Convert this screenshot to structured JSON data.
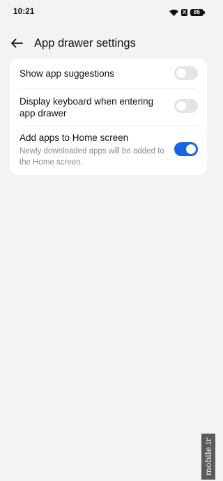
{
  "status_bar": {
    "time": "10:21",
    "battery": "85",
    "badge": "X"
  },
  "header": {
    "title": "App drawer settings",
    "back_icon": "arrow-left-icon"
  },
  "settings": [
    {
      "title": "Show app suggestions",
      "subtitle": "",
      "enabled": false
    },
    {
      "title": "Display keyboard when entering app drawer",
      "subtitle": "",
      "enabled": false
    },
    {
      "title": "Add apps to Home screen",
      "subtitle": "Newly downloaded apps will be added to the Home screen.",
      "enabled": true
    }
  ],
  "colors": {
    "background": "#f3f3f3",
    "card": "#ffffff",
    "toggle_on": "#1565e6",
    "toggle_off": "#e4e4e4",
    "subtitle": "#8a8a8a"
  },
  "watermark": "mobile.ir"
}
